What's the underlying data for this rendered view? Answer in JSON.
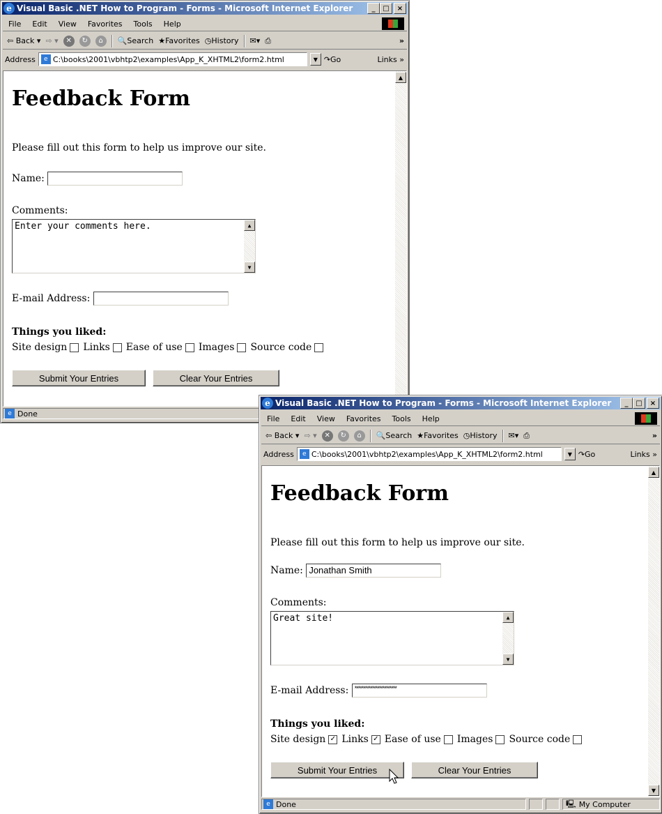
{
  "windows": [
    {
      "title": "Visual Basic .NET How to Program - Forms - Microsoft Internet Explorer",
      "menu": [
        "File",
        "Edit",
        "View",
        "Favorites",
        "Tools",
        "Help"
      ],
      "toolbar": {
        "back": "Back",
        "search": "Search",
        "favorites": "Favorites",
        "history": "History"
      },
      "address_label": "Address",
      "address": "C:\\books\\2001\\vbhtp2\\examples\\App_K_XHTML2\\form2.html",
      "go": "Go",
      "links": "Links",
      "page": {
        "heading": "Feedback Form",
        "intro": "Please fill out this form to help us improve our site.",
        "name_label": "Name:",
        "name_value": "",
        "comments_label": "Comments:",
        "comments_value": "Enter your comments here.",
        "email_label": "E-mail Address:",
        "email_value": "",
        "liked_label": "Things you liked:",
        "options": [
          {
            "label": "Site design",
            "checked": false
          },
          {
            "label": "Links",
            "checked": false
          },
          {
            "label": "Ease of use",
            "checked": false
          },
          {
            "label": "Images",
            "checked": false
          },
          {
            "label": "Source code",
            "checked": false
          }
        ],
        "submit": "Submit Your Entries",
        "clear": "Clear Your Entries"
      },
      "status": "Done"
    },
    {
      "title": "Visual Basic .NET How to Program - Forms - Microsoft Internet Explorer",
      "menu": [
        "File",
        "Edit",
        "View",
        "Favorites",
        "Tools",
        "Help"
      ],
      "toolbar": {
        "back": "Back",
        "search": "Search",
        "favorites": "Favorites",
        "history": "History"
      },
      "address_label": "Address",
      "address": "C:\\books\\2001\\vbhtp2\\examples\\App_K_XHTML2\\form2.html",
      "go": "Go",
      "links": "Links",
      "page": {
        "heading": "Feedback Form",
        "intro": "Please fill out this form to help us improve our site.",
        "name_label": "Name:",
        "name_value": "Jonathan Smith",
        "comments_label": "Comments:",
        "comments_value": "Great site!",
        "email_label": "E-mail Address:",
        "email_value": "************************",
        "liked_label": "Things you liked:",
        "options": [
          {
            "label": "Site design",
            "checked": true
          },
          {
            "label": "Links",
            "checked": true
          },
          {
            "label": "Ease of use",
            "checked": false
          },
          {
            "label": "Images",
            "checked": false
          },
          {
            "label": "Source code",
            "checked": false
          }
        ],
        "submit": "Submit Your Entries",
        "clear": "Clear Your Entries"
      },
      "status": "Done",
      "zone": "My Computer"
    }
  ],
  "colors": {
    "titlebar_start": "#0a246a",
    "titlebar_end": "#a6caf0",
    "chrome": "#d4d0c8"
  }
}
